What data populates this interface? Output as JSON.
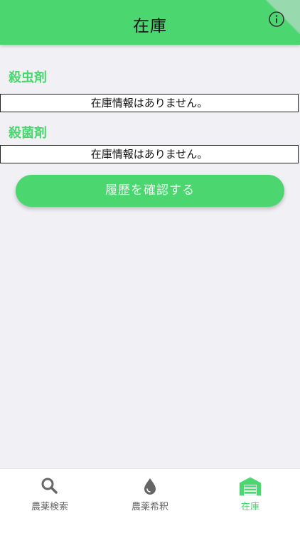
{
  "header": {
    "title": "在庫",
    "info_icon": "info-icon"
  },
  "sections": [
    {
      "title": "殺虫剤",
      "message": "在庫情報はありません。"
    },
    {
      "title": "殺菌剤",
      "message": "在庫情報はありません。"
    }
  ],
  "history_button": {
    "label": "履歴を確認する"
  },
  "tabs": [
    {
      "label": "農薬検索",
      "icon": "search-icon",
      "active": false
    },
    {
      "label": "農薬希釈",
      "icon": "drop-icon",
      "active": false
    },
    {
      "label": "在庫",
      "icon": "warehouse-icon",
      "active": true
    }
  ],
  "colors": {
    "accent": "#4cd670",
    "background": "#f0f0f5",
    "inactive_tab": "#666666"
  }
}
